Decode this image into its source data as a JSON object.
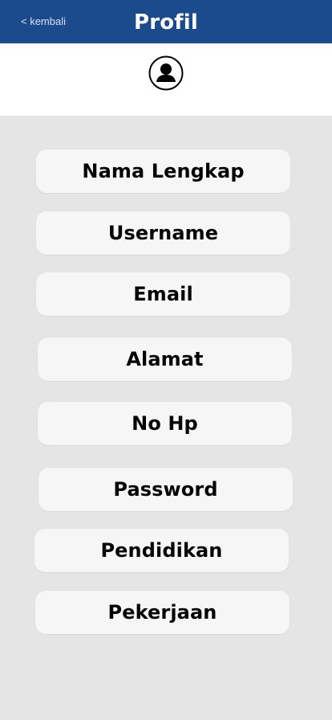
{
  "header": {
    "back_label": "< kembali",
    "title": "Profil"
  },
  "avatar": {
    "icon": "user-avatar-icon"
  },
  "fields": [
    {
      "label": "Nama Lengkap"
    },
    {
      "label": "Username"
    },
    {
      "label": "Email"
    },
    {
      "label": "Alamat"
    },
    {
      "label": "No Hp"
    },
    {
      "label": "Password"
    },
    {
      "label": "Pendidikan"
    },
    {
      "label": "Pekerjaan"
    }
  ],
  "colors": {
    "header_bg": "#1b4a8d",
    "page_bg": "#e5e5e5",
    "card_bg": "#f6f6f6"
  }
}
